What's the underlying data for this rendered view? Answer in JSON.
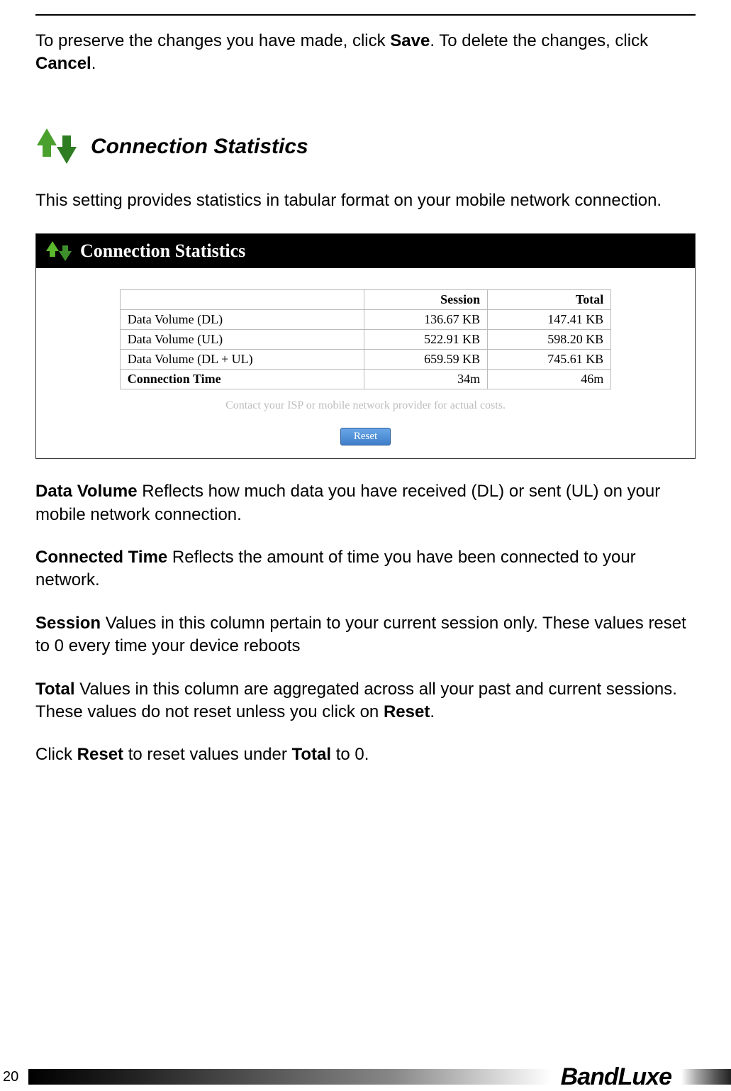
{
  "intro": {
    "pre": "To preserve the changes you have made, click ",
    "save": "Save",
    "mid": ". To delete the changes, click ",
    "cancel": "Cancel",
    "end": "."
  },
  "section": {
    "title": "Connection Statistics",
    "desc": "This setting provides statistics in tabular format on your mobile network connection."
  },
  "panel": {
    "title": "Connection Statistics",
    "headers": {
      "blank": "",
      "session": "Session",
      "total": "Total"
    },
    "rows": [
      {
        "label": "Data Volume (DL)",
        "session": "136.67 KB",
        "total": "147.41 KB",
        "bold": false
      },
      {
        "label": "Data Volume (UL)",
        "session": "522.91 KB",
        "total": "598.20 KB",
        "bold": false
      },
      {
        "label": "Data Volume (DL + UL)",
        "session": "659.59 KB",
        "total": "745.61 KB",
        "bold": false
      },
      {
        "label": "Connection Time",
        "session": "34m",
        "total": "46m",
        "bold": true
      }
    ],
    "disclaimer": "Contact your ISP or mobile network provider for actual costs.",
    "reset_label": "Reset"
  },
  "defs": {
    "data_volume": {
      "term": "Data Volume",
      "text": " Reflects how much data you have received (DL) or sent (UL) on your mobile network connection."
    },
    "connected_time": {
      "term": "Connected Time",
      "text": " Reflects the amount of time you have been connected to your network."
    },
    "session": {
      "term": "Session",
      "text": " Values in this column pertain to your current session only. These values reset to 0 every time your device reboots"
    },
    "total": {
      "term": "Total",
      "pre": " Values in this column are aggregated across all your past and current sessions. These values do not reset unless you click on ",
      "reset": "Reset",
      "end": "."
    },
    "reset_line": {
      "pre": "Click ",
      "reset": "Reset",
      "mid": " to reset values under ",
      "total": "Total",
      "end": " to 0."
    }
  },
  "footer": {
    "page": "20",
    "brand": "BandLuxe"
  }
}
